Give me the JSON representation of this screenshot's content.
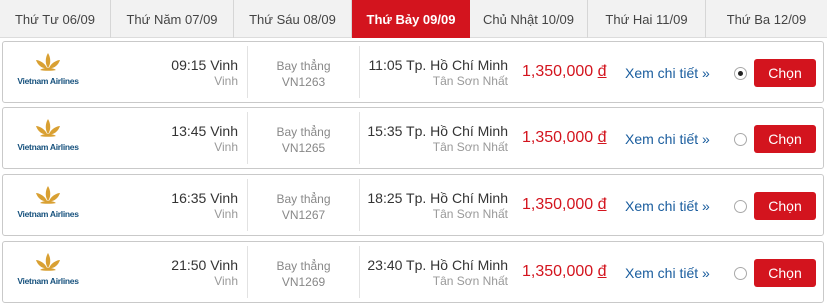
{
  "date_tabs": [
    {
      "label": "Thứ Tư 06/09",
      "active": false
    },
    {
      "label": "Thứ Năm 07/09",
      "active": false
    },
    {
      "label": "Thứ Sáu 08/09",
      "active": false
    },
    {
      "label": "Thứ Bảy 09/09",
      "active": true
    },
    {
      "label": "Chủ Nhật 10/09",
      "active": false
    },
    {
      "label": "Thứ Hai 11/09",
      "active": false
    },
    {
      "label": "Thứ Ba 12/09",
      "active": false
    }
  ],
  "colors": {
    "accent": "#d3141e",
    "link": "#1a5d9e",
    "logo_gold": "#d9a032",
    "logo_blue": "#16517d"
  },
  "flights": [
    {
      "airline": "Vietnam Airlines",
      "dep_time_city": "09:15 Vinh",
      "dep_airport": "Vinh",
      "flight_type": "Bay thẳng",
      "flight_code": "VN1263",
      "arr_time_city": "11:05 Tp. Hồ Chí Minh",
      "arr_airport": "Tân Sơn Nhất",
      "price": "1,350,000",
      "currency": "đ",
      "details_label": "Xem chi tiết »",
      "selected": true,
      "choose_label": "Chọn"
    },
    {
      "airline": "Vietnam Airlines",
      "dep_time_city": "13:45 Vinh",
      "dep_airport": "Vinh",
      "flight_type": "Bay thẳng",
      "flight_code": "VN1265",
      "arr_time_city": "15:35 Tp. Hồ Chí Minh",
      "arr_airport": "Tân Sơn Nhất",
      "price": "1,350,000",
      "currency": "đ",
      "details_label": "Xem chi tiết »",
      "selected": false,
      "choose_label": "Chọn"
    },
    {
      "airline": "Vietnam Airlines",
      "dep_time_city": "16:35 Vinh",
      "dep_airport": "Vinh",
      "flight_type": "Bay thẳng",
      "flight_code": "VN1267",
      "arr_time_city": "18:25 Tp. Hồ Chí Minh",
      "arr_airport": "Tân Sơn Nhất",
      "price": "1,350,000",
      "currency": "đ",
      "details_label": "Xem chi tiết »",
      "selected": false,
      "choose_label": "Chọn"
    },
    {
      "airline": "Vietnam Airlines",
      "dep_time_city": "21:50 Vinh",
      "dep_airport": "Vinh",
      "flight_type": "Bay thẳng",
      "flight_code": "VN1269",
      "arr_time_city": "23:40 Tp. Hồ Chí Minh",
      "arr_airport": "Tân Sơn Nhất",
      "price": "1,350,000",
      "currency": "đ",
      "details_label": "Xem chi tiết »",
      "selected": false,
      "choose_label": "Chọn"
    }
  ]
}
